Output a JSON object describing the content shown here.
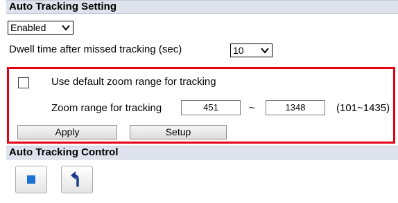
{
  "auto_tracking_setting": {
    "title": "Auto Tracking Setting",
    "enabled_select": {
      "value": "Enabled"
    },
    "dwell": {
      "label": "Dwell time after missed tracking (sec)",
      "value": "10"
    },
    "default_zoom": {
      "label": "Use default zoom range for tracking",
      "checked": false
    },
    "zoom_range": {
      "label": "Zoom range for tracking",
      "min": "451",
      "separator": "~",
      "max": "1348",
      "hint": "(101~1435)"
    },
    "apply_label": "Apply",
    "setup_label": "Setup",
    "highlight_color": "#e60012"
  },
  "auto_tracking_control": {
    "title": "Auto Tracking Control",
    "buttons": [
      {
        "icon": "stop-square-icon",
        "color": "#1e73d2"
      },
      {
        "icon": "return-arrow-icon",
        "color": "#1a3a8a"
      }
    ]
  }
}
